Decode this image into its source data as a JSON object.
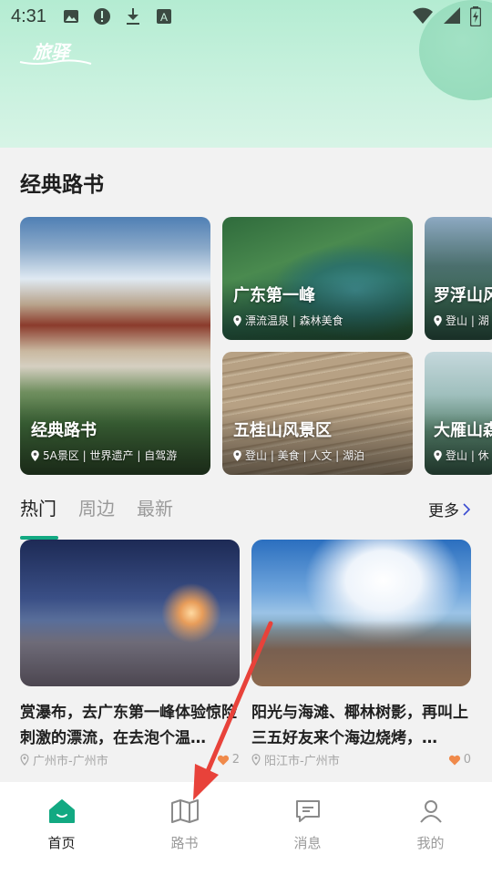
{
  "status_bar": {
    "time": "4:31"
  },
  "header": {
    "logo_text": "旅驿"
  },
  "classic": {
    "title": "经典路书",
    "cards": [
      {
        "title": "经典路书",
        "tags": "5A景区 | 世界遗产 | 自驾游"
      },
      {
        "title": "广东第一峰",
        "tags": "漂流温泉 | 森林美食"
      },
      {
        "title": "五桂山风景区",
        "tags": "登山 | 美食 | 人文 | 湖泊"
      },
      {
        "title": "罗浮山风",
        "tags": "登山 | 湖"
      },
      {
        "title": "大雁山森",
        "tags": "登山 | 休"
      }
    ]
  },
  "tabs": [
    {
      "label": "热门"
    },
    {
      "label": "周边"
    },
    {
      "label": "最新"
    }
  ],
  "more_label": "更多",
  "feed": [
    {
      "title": "赏瀑布，去广东第一峰体验惊险刺激的漂流，在去泡个温…",
      "location": "广州市-广州市",
      "likes": "2"
    },
    {
      "title": "阳光与海滩、椰林树影，再叫上三五好友来个海边烧烤，…",
      "location": "阳江市-广州市",
      "likes": "0"
    }
  ],
  "bottom_nav": [
    {
      "label": "首页",
      "icon": "home-icon"
    },
    {
      "label": "路书",
      "icon": "map-icon"
    },
    {
      "label": "消息",
      "icon": "message-icon"
    },
    {
      "label": "我的",
      "icon": "person-icon"
    }
  ],
  "colors": {
    "accent": "#12a982",
    "header": "#c6f0dc",
    "annotation_arrow": "#e8423a",
    "like_heart": "#f08a4b"
  }
}
